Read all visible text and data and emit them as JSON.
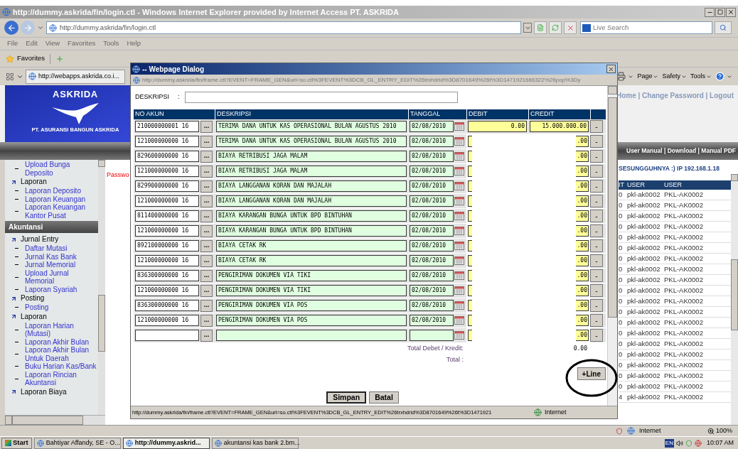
{
  "browser": {
    "title": "http://dummy.askrida/fin/login.ctl - Windows Internet Explorer provided by Internet Access PT. ASKRIDA",
    "address": "http://dummy.askrida/fin/login.ctl",
    "search_placeholder": "Live Search",
    "menu": [
      "File",
      "Edit",
      "View",
      "Favorites",
      "Tools",
      "Help"
    ],
    "favorites": "Favorites",
    "tab": "http://webapps.askrida.co.i...",
    "tools": [
      "Page",
      "Safety",
      "Tools"
    ]
  },
  "banner": {
    "name": "ASKRIDA",
    "subtitle": "PT. ASURANSI BANGUN ASKRIDA"
  },
  "top_links": "Home | Change Password | Logout",
  "help_links": "User Manual | Download | Manual PDF",
  "sidebar": [
    {
      "kind": "link",
      "label": "Upload Bunga Deposito"
    },
    {
      "kind": "group",
      "label": "Laporan",
      "children": [
        {
          "kind": "link",
          "label": "Laporan Deposito"
        },
        {
          "kind": "link",
          "label": "Laporan Keuangan"
        },
        {
          "kind": "link",
          "label": "Laporan Keuangan Kantor Pusat"
        }
      ]
    },
    {
      "kind": "section",
      "label": "Akuntansi"
    },
    {
      "kind": "group",
      "label": "Jurnal Entry",
      "children": [
        {
          "kind": "link",
          "label": "Daftar Mutasi"
        },
        {
          "kind": "link",
          "label": "Jurnal Kas Bank"
        },
        {
          "kind": "link",
          "label": "Jurnal Memorial"
        },
        {
          "kind": "link",
          "label": "Upload Jurnal Memorial"
        },
        {
          "kind": "link",
          "label": "Laporan Syariah"
        }
      ]
    },
    {
      "kind": "group",
      "label": "Posting",
      "children": [
        {
          "kind": "link",
          "label": "Posting"
        }
      ]
    },
    {
      "kind": "group",
      "label": "Laporan",
      "children": [
        {
          "kind": "link",
          "label": "Laporan Harian (Mutasi)"
        },
        {
          "kind": "link",
          "label": "Laporan Akhir Bulan"
        },
        {
          "kind": "link",
          "label": "Laporan Akhir Bulan Untuk Daerah"
        },
        {
          "kind": "link",
          "label": "Buku Harian Kas/Bank"
        },
        {
          "kind": "link",
          "label": "Laporan Rincian Akuntansi"
        }
      ]
    },
    {
      "kind": "group",
      "label": "Laporan Biaya"
    }
  ],
  "notice": "Passwo",
  "greeting": "SESUNGGUHNYA :) IP 192.168.1.18",
  "user_table": {
    "columns": [
      "IT",
      "USER",
      "USER"
    ],
    "rows": [
      [
        "0",
        "pkl-ak0002",
        "PKL-AK0002"
      ],
      [
        "0",
        "pkl-ak0002",
        "PKL-AK0002"
      ],
      [
        "0",
        "pkl-ak0002",
        "PKL-AK0002"
      ],
      [
        "0",
        "pkl-ak0002",
        "PKL-AK0002"
      ],
      [
        "0",
        "pkl-ak0002",
        "PKL-AK0002"
      ],
      [
        "0",
        "pkl-ak0002",
        "PKL-AK0002"
      ],
      [
        "0",
        "pkl-ak0002",
        "PKL-AK0002"
      ],
      [
        "0",
        "pkl-ak0002",
        "PKL-AK0002"
      ],
      [
        "0",
        "pkl-ak0002",
        "PKL-AK0002"
      ],
      [
        "0",
        "pkl-ak0002",
        "PKL-AK0002"
      ],
      [
        "0",
        "pkl-ak0002",
        "PKL-AK0002"
      ],
      [
        "0",
        "pkl-ak0002",
        "PKL-AK0002"
      ],
      [
        "0",
        "pkl-ak0002",
        "PKL-AK0002"
      ],
      [
        "0",
        "pkl-ak0002",
        "PKL-AK0002"
      ],
      [
        "0",
        "pkl-ak0002",
        "PKL-AK0002"
      ],
      [
        "0",
        "pkl-ak0002",
        "PKL-AK0002"
      ],
      [
        "0",
        "pkl-ak0002",
        "PKL-AK0002"
      ],
      [
        "0",
        "pkl-ak0002",
        "PKL-AK0002"
      ],
      [
        "0",
        "pkl-ak0002",
        "PKL-AK0002"
      ],
      [
        "4",
        "pkl-ak0002",
        "PKL-AK0002"
      ]
    ]
  },
  "dialog": {
    "title": "-- Webpage Dialog",
    "address": "http://dummy.askrida/fin/frame.ctl?EVENT=FRAME_GEN&url=so.ctl%3FEVENT%3DCB_GL_ENTRY_EDIT%26trxhdrid%3D8701649%26t%3D1471921666322%26pop%3Dy",
    "description_label": "DESKRIPSI",
    "description_colon": ":",
    "columns": [
      "NO AKUN",
      "DESKRIPSI",
      "TANGGAL",
      "DEBIT",
      "CREDIT"
    ],
    "rows": [
      {
        "account": "210000000001 16",
        "browse": "...",
        "description": "TERIMA DANA UNTUK KAS OPERASIONAL BULAN AGUSTUS 2010",
        "date": "02/08/2010",
        "debit": "0.00",
        "credit": "15.000.000.00",
        "remove": "-"
      },
      {
        "account": "121000000000 16",
        "browse": "...",
        "description": "TERIMA DANA UNTUK KAS OPERASIONAL BULAN AGUSTUS 2010",
        "date": "02/08/2010",
        "credit": ".00",
        "remove": "-"
      },
      {
        "account": "829600000000 16",
        "browse": "...",
        "description": "BIAYA RETRIBUSI JAGA MALAM",
        "date": "02/08/2010",
        "credit": ".00",
        "remove": "-"
      },
      {
        "account": "121000000000 16",
        "browse": "...",
        "description": "BIAYA RETRIBUSI JAGA MALAM",
        "date": "02/08/2010",
        "credit": ".00",
        "remove": "-"
      },
      {
        "account": "829900000000 16",
        "browse": "...",
        "description": "BIAYA LANGGANAN KORAN DAN MAJALAH",
        "date": "02/08/2010",
        "credit": ".00",
        "remove": "-"
      },
      {
        "account": "121000000000 16",
        "browse": "...",
        "description": "BIAYA LANGGANAN KORAN DAN MAJALAH",
        "date": "02/08/2010",
        "credit": ".00",
        "remove": "-"
      },
      {
        "account": "811400000000 16",
        "browse": "...",
        "description": "BIAYA KARANGAN BUNGA UNTUK BPD BINTUHAN",
        "date": "02/08/2010",
        "credit": ".00",
        "remove": "-"
      },
      {
        "account": "121000000000 16",
        "browse": "...",
        "description": "BIAYA KARANGAN BUNGA UNTUK BPD BINTUHAN",
        "date": "02/08/2010",
        "credit": ".00",
        "remove": "-"
      },
      {
        "account": "892100000000 16",
        "browse": "...",
        "description": "BIAYA CETAK RK",
        "date": "02/08/2010",
        "credit": ".00",
        "remove": "-"
      },
      {
        "account": "121000000000 16",
        "browse": "...",
        "description": "BIAYA CETAK RK",
        "date": "02/08/2010",
        "credit": ".00",
        "remove": "-"
      },
      {
        "account": "836300000000 16",
        "browse": "...",
        "description": "PENGIRIMAN DOKUMEN VIA TIKI",
        "date": "02/08/2010",
        "credit": ".00",
        "remove": "-"
      },
      {
        "account": "121000000000 16",
        "browse": "...",
        "description": "PENGIRIMAN DOKUMEN VIA TIKI",
        "date": "02/08/2010",
        "credit": ".00",
        "remove": "-"
      },
      {
        "account": "836300000000 16",
        "browse": "...",
        "description": "PENGIRIMAN DOKUMEN VIA POS",
        "date": "02/08/2010",
        "credit": ".00",
        "remove": "-"
      },
      {
        "account": "121000000000 16",
        "browse": "...",
        "description": "PENGIRIMAN DOKUMEN VIA POS",
        "date": "02/08/2010",
        "credit": ".00",
        "remove": "-"
      },
      {
        "browse": "...",
        "credit": ".00",
        "remove": "-"
      }
    ],
    "total_label": "Total Debet / Kredit:",
    "total_value": "0.00",
    "grand_total_label": "Total :",
    "add_line": "+Line",
    "buttons": [
      "Simpan",
      "Batal"
    ],
    "status_url": "http://dummy.askrida/fin/frame.ctl?EVENT=FRAME_GEN&url=so.ctl%3FEVENT%3DCB_GL_ENTRY_EDIT%26trxhdrid%3D8701649%26t%3D1471921",
    "zone": "Internet"
  },
  "status_bar": {
    "zone": "Internet",
    "zoom": "100%"
  },
  "taskbar": {
    "start": "Start",
    "items": [
      {
        "label": "Bahtiyar Affandy, SE - O...",
        "selected": false
      },
      {
        "label": "http://dummy.askrid...",
        "selected": true
      },
      {
        "label": "akuntansi kas bank 2.bm...",
        "selected": false
      }
    ],
    "language": "EN",
    "clock": "10:07 AM"
  }
}
